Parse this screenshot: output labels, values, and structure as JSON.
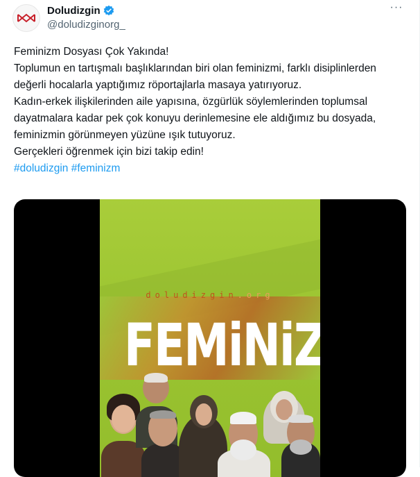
{
  "author": {
    "name": "Doludizgin",
    "handle": "@doludizginorg_",
    "verified": true,
    "avatar_icon": "doludizgin-logo-icon",
    "accent": "#c8202a"
  },
  "menu_icon": "more-options-icon",
  "tweet": {
    "paragraph_1": "Feminizm Dosyası Çok Yakında!\nToplumun en tartışmalı başlıklarından biri olan feminizmi, farklı disiplinlerden değerli hocalarla yaptığımız röportajlarla masaya yatırıyoruz.",
    "paragraph_2": "Kadın-erkek ilişkilerinden aile yapısına, özgürlük söylemlerinden toplumsal dayatmalara kadar pek çok konuyu derinlemesine ele aldığımız bu dosyada, feminizmin görünmeyen yüzüne ışık tutuyoruz.\nGerçekleri öğrenmek için bizi takip edin!",
    "hashtags": [
      "#doludizgin",
      "#feminizm"
    ],
    "link_color": "#1d9bf0"
  },
  "media": {
    "site_text": "doludizgin",
    "site_suffix": ".org",
    "headline": "FEMiNiZM",
    "background_color": "#a3c935"
  }
}
